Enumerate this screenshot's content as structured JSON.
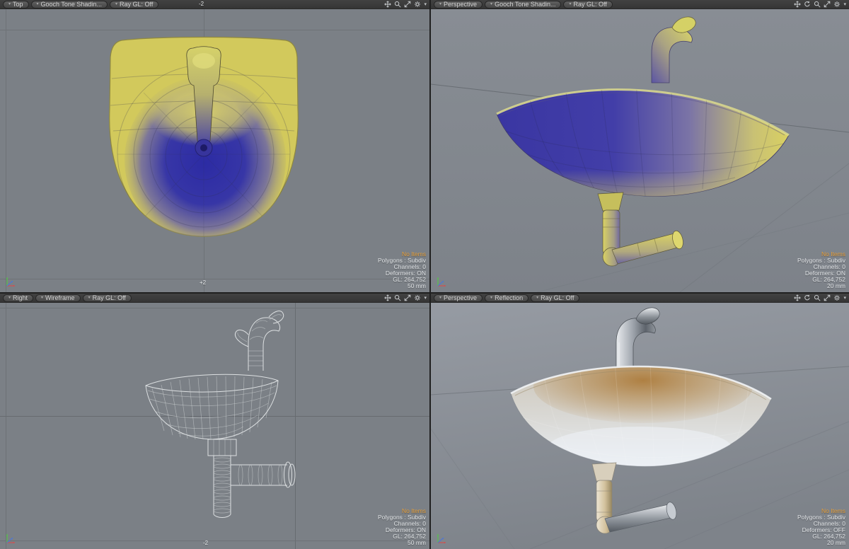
{
  "colors": {
    "gooch_blue": "#3534a4",
    "gooch_yellow": "#d6cd5e",
    "status_orange": "#e8a03a",
    "viewport_bg": "#7b8086",
    "header_bg": "#3b3b3b"
  },
  "icons": {
    "dropdown": "▾",
    "names": [
      "pan",
      "rotate",
      "zoom",
      "maximize",
      "settings"
    ]
  },
  "viewports": [
    {
      "id": "top",
      "view_label": "Top",
      "shading_label": "Gooch Tone Shadin...",
      "raygl_label": "Ray GL: Off",
      "grid_labels": [
        {
          "text": "-2"
        },
        {
          "text": "+2"
        }
      ],
      "status": {
        "no_items": "No Items",
        "polygons": "Polygons : Subdiv",
        "channels": "Channels: 0",
        "deformers": "Deformers: ON",
        "gl": "GL: 264,752",
        "scale": "50 mm"
      }
    },
    {
      "id": "perspective-gooch",
      "view_label": "Perspective",
      "shading_label": "Gooch Tone Shadin...",
      "raygl_label": "Ray GL: Off",
      "grid_labels": [],
      "status": {
        "no_items": "No Items",
        "polygons": "Polygons : Subdiv",
        "channels": "Channels: 0",
        "deformers": "Deformers: ON",
        "gl": "GL: 264,752",
        "scale": "20 mm"
      }
    },
    {
      "id": "right",
      "view_label": "Right",
      "shading_label": "Wireframe",
      "raygl_label": "Ray GL: Off",
      "grid_labels": [
        {
          "text": "-2"
        }
      ],
      "status": {
        "no_items": "No Items",
        "polygons": "Polygons : Subdiv",
        "channels": "Channels: 0",
        "deformers": "Deformers: ON",
        "gl": "GL: 264,752",
        "scale": "50 mm"
      }
    },
    {
      "id": "perspective-reflection",
      "view_label": "Perspective",
      "shading_label": "Reflection",
      "raygl_label": "Ray GL: Off",
      "grid_labels": [],
      "status": {
        "no_items": "No Items",
        "polygons": "Polygons : Subdiv",
        "channels": "Channels: 0",
        "deformers": "Deformers: OFF",
        "gl": "GL: 264,752",
        "scale": "20 mm"
      }
    }
  ]
}
